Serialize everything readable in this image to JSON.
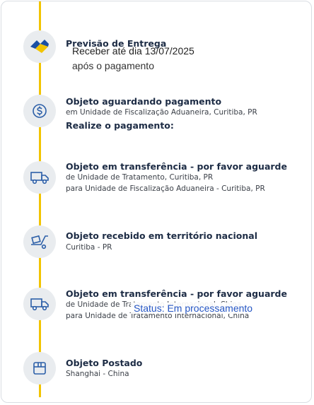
{
  "delivery_forecast": {
    "title": "Previsão de Entrega",
    "date_text": "Receber até dia 13/07/2025",
    "condition_text": "após o pagamento"
  },
  "steps": [
    {
      "title": "Objeto aguardando pagamento",
      "line1": "em Unidade de Fiscalização Aduaneira, Curitiba, PR",
      "action": "Realize o pagamento:",
      "icon": "dollar-coin-icon"
    },
    {
      "title": "Objeto em transferência - por favor aguarde",
      "line1": "de Unidade de Tratamento, Curitiba, PR",
      "line2": "para Unidade de Fiscalização Aduaneira - Curitiba, PR",
      "icon": "truck-icon"
    },
    {
      "title": "Objeto recebido em território nacional",
      "line1": "Curitiba - PR",
      "icon": "package-cart-icon"
    },
    {
      "title": "Objeto em transferência - por favor aguarde",
      "line1": "de Unidade de Tratamento Internacional, China",
      "line2": "para Unidade de Tratamento Internacional, China",
      "icon": "truck-icon"
    },
    {
      "title": "Objeto Postado",
      "line1": "Shanghai - China",
      "icon": "box-icon"
    }
  ],
  "status_overlay": "Status: Em processamento",
  "colors": {
    "timeline": "#f2c400",
    "title": "#1d2c45",
    "status": "#2455c3",
    "icon_stroke": "#2c5fa8"
  }
}
